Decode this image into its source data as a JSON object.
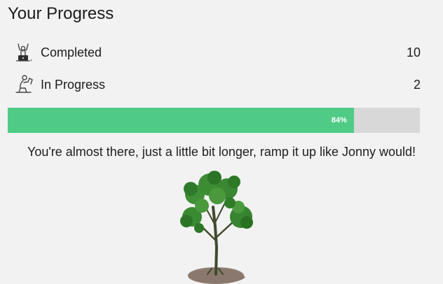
{
  "header": {
    "title": "Your Progress"
  },
  "stats": {
    "completed": {
      "label": "Completed",
      "value": "10",
      "icon": "celebrating-person-laptop-icon"
    },
    "in_progress": {
      "label": "In Progress",
      "value": "2",
      "icon": "person-at-laptop-icon"
    }
  },
  "progress": {
    "percent": 84,
    "label": "84%",
    "fill_color": "#50cb86",
    "track_color": "#d8d8d8"
  },
  "message": "You're almost there, just a little bit longer, ramp it up like Jonny would!",
  "illustration": {
    "icon": "growing-tree-icon"
  }
}
